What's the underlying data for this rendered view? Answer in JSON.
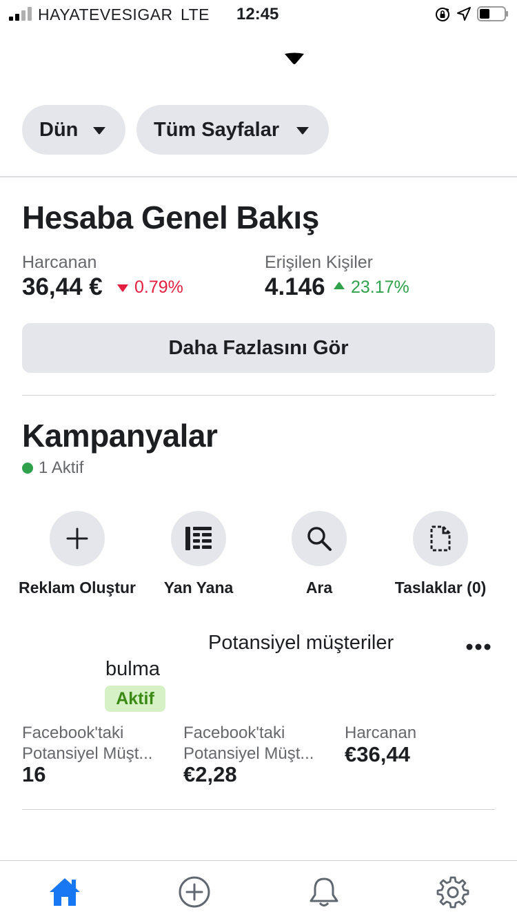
{
  "status_bar": {
    "carrier": "HAYATEVESIGAR",
    "network": "LTE",
    "time": "12:45"
  },
  "filters": {
    "date_label": "Dün",
    "pages_label": "Tüm Sayfalar"
  },
  "overview": {
    "title": "Hesaba Genel Bakış",
    "spent_label": "Harcanan",
    "spent_value": "36,44 €",
    "spent_delta": "0.79%",
    "reach_label": "Erişilen Kişiler",
    "reach_value": "4.146",
    "reach_delta": "23.17%",
    "see_more_label": "Daha Fazlasını Gör"
  },
  "campaigns": {
    "title": "Kampanyalar",
    "active_count": "1 Aktif",
    "actions": [
      {
        "label": "Reklam Oluştur",
        "icon": "plus-icon"
      },
      {
        "label": "Yan Yana",
        "icon": "list-icon"
      },
      {
        "label": "Ara",
        "icon": "search-icon"
      },
      {
        "label": "Taslaklar (0)",
        "icon": "draft-icon"
      }
    ],
    "item": {
      "name_line1": "Potansiyel müşteriler",
      "name_line2": "bulma",
      "status": "Aktif",
      "stats": [
        {
          "label_line1": "Facebook'taki",
          "label_line2": "Potansiyel Müşt...",
          "value": "16"
        },
        {
          "label_line1": "Facebook'taki",
          "label_line2": "Potansiyel Müşt...",
          "value": "€2,28"
        },
        {
          "label_line1": "Harcanan",
          "label_line2": "",
          "value": "€36,44"
        }
      ]
    }
  },
  "tab_bar": {
    "items": [
      "home-icon",
      "create-icon",
      "notifications-icon",
      "settings-icon"
    ],
    "active_color": "#1877f2"
  },
  "colors": {
    "negative": "#e41e3f",
    "positive": "#31a24c",
    "pill_background": "#e4e6eb",
    "badge_background": "#d5f1c5",
    "badge_text": "#3b8a16"
  }
}
